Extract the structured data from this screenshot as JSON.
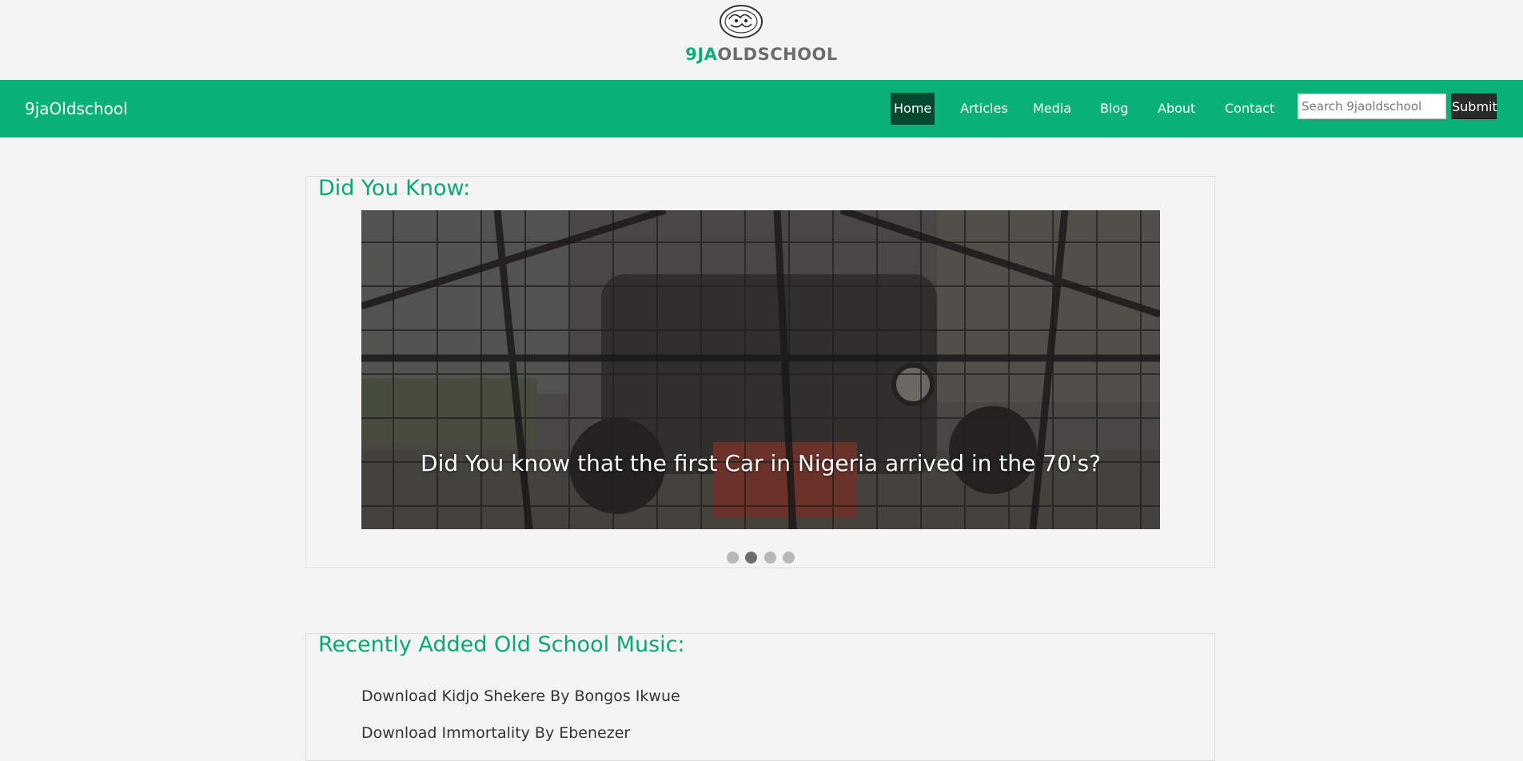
{
  "logo": {
    "text_a": "9JA",
    "text_b": "OLDSCHOOL"
  },
  "navbar": {
    "brand": "9jaOldschool",
    "items": [
      {
        "label": "Home",
        "active": true
      },
      {
        "label": "Articles",
        "active": false
      },
      {
        "label": "Media",
        "active": false
      },
      {
        "label": "Blog",
        "active": false
      },
      {
        "label": "About",
        "active": false
      },
      {
        "label": "Contact",
        "active": false
      }
    ],
    "search": {
      "placeholder": "Search 9jaoldschool",
      "button": "Submit"
    }
  },
  "did_you_know": {
    "title": "Did You Know:",
    "caption": "Did You know that the first Car in Nigeria arrived in the 70's?",
    "slide_count": 4,
    "active_slide": 2
  },
  "music": {
    "title": "Recently Added Old School Music:",
    "items": [
      "Download Kidjo Shekere By Bongos Ikwue",
      "Download Immortality By Ebenezer"
    ]
  },
  "colors": {
    "brand_green": "#09b077",
    "active_nav": "#04492f"
  }
}
